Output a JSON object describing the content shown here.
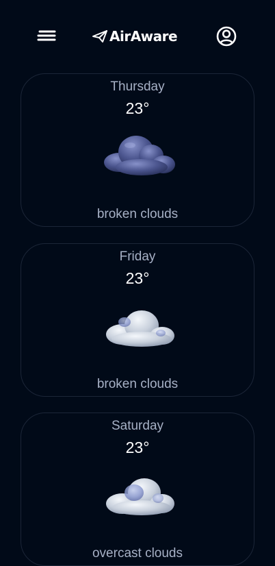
{
  "header": {
    "logo_text": "AirAware",
    "menu_icon": "menu-icon",
    "logo_icon": "paper-plane-icon",
    "profile_icon": "user-circle-icon"
  },
  "forecast": [
    {
      "day": "Thursday",
      "temp": "23°",
      "description": "broken clouds",
      "icon": "dark-broken-clouds-icon"
    },
    {
      "day": "Friday",
      "temp": "23°",
      "description": "broken clouds",
      "icon": "light-broken-clouds-icon"
    },
    {
      "day": "Saturday",
      "temp": "23°",
      "description": "overcast clouds",
      "icon": "overcast-clouds-icon"
    }
  ],
  "colors": {
    "background": "#010a18",
    "card_border": "#1c2638",
    "muted_text": "#a7b1c6",
    "primary_text": "#ffffff"
  }
}
